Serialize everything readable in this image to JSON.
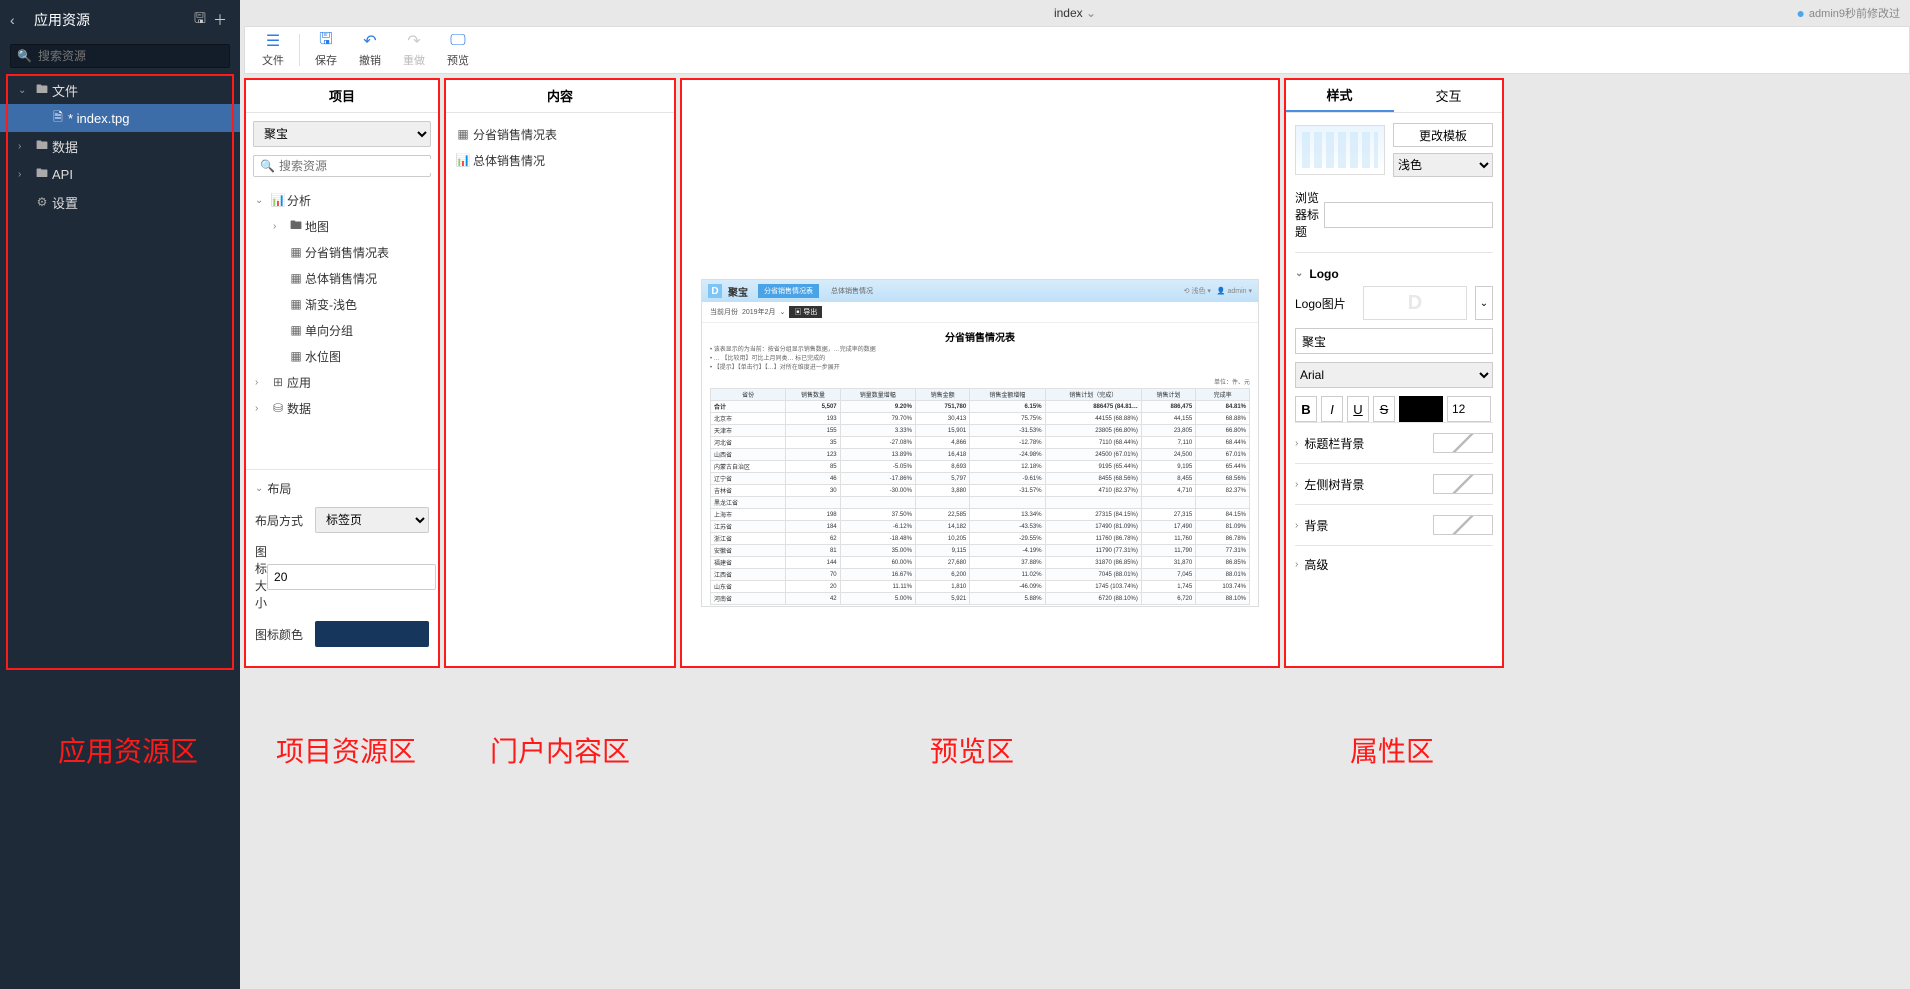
{
  "topbar": {
    "title": "index",
    "modified_by": "admin9秒前修改过"
  },
  "sidebar": {
    "title": "应用资源",
    "search_placeholder": "搜索资源",
    "nodes": {
      "files": "文件",
      "index_file": "* index.tpg",
      "data": "数据",
      "api": "API",
      "settings": "设置"
    }
  },
  "toolbar": {
    "file": "文件",
    "save": "保存",
    "undo": "撤销",
    "redo": "重做",
    "preview": "预览"
  },
  "project": {
    "title": "项目",
    "select_value": "聚宝",
    "search_placeholder": "搜索资源",
    "nodes": {
      "analysis": "分析",
      "map": "地图",
      "prov_sales": "分省销售情况表",
      "overall_sales": "总体销售情况",
      "gradient_light": "渐变-浅色",
      "single_group": "单向分组",
      "water_level": "水位图",
      "app": "应用",
      "data": "数据"
    },
    "layout": {
      "header": "布局",
      "mode_label": "布局方式",
      "mode_value": "标签页",
      "icon_size_label": "图标大小",
      "icon_size_value": "20",
      "icon_color_label": "图标颜色",
      "icon_color_value": "#16365c"
    }
  },
  "content": {
    "title": "内容",
    "items": [
      "分省销售情况表",
      "总体销售情况"
    ]
  },
  "preview": {
    "app_name": "聚宝",
    "tab1": "分省销售情况表",
    "tab2": "总体销售情况",
    "theme_light": "浅色",
    "user": "admin",
    "current_month_label": "当前月份",
    "current_month_value": "2019年2月",
    "export_label": "导出",
    "report_title": "分省销售情况表",
    "notes": [
      "该表显示的为当前：按省分组显示销售数据，…完成率的数据",
      "… 【比较用】可比上月同类… 标已完成的",
      "【提示】【单击行】【…】对所在维度进一步展开"
    ],
    "unit": "单位：件、元",
    "columns": [
      "省份",
      "销售数量",
      "销量数量增幅",
      "销售金额",
      "销售金额增幅",
      "销售计划（完成）",
      "销售计划",
      "完成率"
    ],
    "rows": [
      [
        "合计",
        "5,507",
        "9.20%",
        "751,780",
        "6.15%",
        "886475 (84.81…",
        "886,475",
        "84.81%"
      ],
      [
        "北京市",
        "193",
        "79.70%",
        "30,413",
        "75.75%",
        "44155 (68.88%)",
        "44,155",
        "68.88%"
      ],
      [
        "天津市",
        "155",
        "3.33%",
        "15,901",
        "-31.53%",
        "23805 (66.80%)",
        "23,805",
        "66.80%"
      ],
      [
        "河北省",
        "35",
        "-27.08%",
        "4,866",
        "-12.78%",
        "7110 (68.44%)",
        "7,110",
        "68.44%"
      ],
      [
        "山西省",
        "123",
        "13.89%",
        "16,418",
        "-24.98%",
        "24500 (67.01%)",
        "24,500",
        "67.01%"
      ],
      [
        "内蒙古自治区",
        "85",
        "-5.05%",
        "8,693",
        "12.18%",
        "9195 (65.44%)",
        "9,195",
        "65.44%"
      ],
      [
        "辽宁省",
        "46",
        "-17.86%",
        "5,797",
        "-9.61%",
        "8455 (68.56%)",
        "8,455",
        "68.56%"
      ],
      [
        "吉林省",
        "30",
        "-30.00%",
        "3,880",
        "-31.57%",
        "4710 (82.37%)",
        "4,710",
        "82.37%"
      ],
      [
        "黑龙江省",
        "",
        "",
        "",
        "",
        "",
        "",
        ""
      ],
      [
        "上海市",
        "198",
        "37.50%",
        "22,585",
        "13.34%",
        "27315 (84.15%)",
        "27,315",
        "84.15%"
      ],
      [
        "江苏省",
        "184",
        "-6.12%",
        "14,182",
        "-43.53%",
        "17490 (81.09%)",
        "17,490",
        "81.09%"
      ],
      [
        "浙江省",
        "62",
        "-18.48%",
        "10,205",
        "-29.55%",
        "11760 (86.78%)",
        "11,760",
        "86.78%"
      ],
      [
        "安徽省",
        "81",
        "35.00%",
        "9,115",
        "-4.19%",
        "11790 (77.31%)",
        "11,790",
        "77.31%"
      ],
      [
        "福建省",
        "144",
        "60.00%",
        "27,680",
        "37.88%",
        "31870 (86.85%)",
        "31,870",
        "86.85%"
      ],
      [
        "江西省",
        "70",
        "16.67%",
        "6,200",
        "11.02%",
        "7045 (88.01%)",
        "7,045",
        "88.01%"
      ],
      [
        "山东省",
        "20",
        "11.11%",
        "1,810",
        "-46.09%",
        "1745 (103.74%)",
        "1,745",
        "103.74%"
      ],
      [
        "河南省",
        "42",
        "5.00%",
        "5,921",
        "5.88%",
        "6720 (88.10%)",
        "6,720",
        "88.10%"
      ]
    ]
  },
  "props": {
    "tab_style": "样式",
    "tab_interact": "交互",
    "change_template": "更改模板",
    "theme_light": "浅色",
    "browser_title_label": "浏览器标题",
    "browser_title_value": "",
    "logo_section": "Logo",
    "logo_image_label": "Logo图片",
    "logo_text": "聚宝",
    "font_value": "Arial",
    "font_size": "12",
    "title_bg": "标题栏背景",
    "left_tree_bg": "左侧树背景",
    "bg": "背景",
    "advanced": "高级"
  },
  "annotations": {
    "sidebar": "应用资源区",
    "project": "项目资源区",
    "content": "门户内容区",
    "preview": "预览区",
    "props": "属性区"
  },
  "chart_data": {
    "type": "table",
    "title": "分省销售情况表",
    "columns": [
      "省份",
      "销售数量",
      "销量数量增幅",
      "销售金额",
      "销售金额增幅",
      "完成率"
    ],
    "rows": [
      {
        "province": "合计",
        "qty": 5507,
        "qty_growth": 9.2,
        "amount": 751780,
        "amount_growth": 6.15,
        "plan": 886475,
        "completion_rate": 84.81
      },
      {
        "province": "北京市",
        "qty": 193,
        "qty_growth": 79.7,
        "amount": 30413,
        "amount_growth": 75.75,
        "plan": 44155,
        "completion_rate": 68.88
      },
      {
        "province": "天津市",
        "qty": 155,
        "qty_growth": 3.33,
        "amount": 15901,
        "amount_growth": -31.53,
        "plan": 23805,
        "completion_rate": 66.8
      },
      {
        "province": "河北省",
        "qty": 35,
        "qty_growth": -27.08,
        "amount": 4866,
        "amount_growth": -12.78,
        "plan": 7110,
        "completion_rate": 68.44
      },
      {
        "province": "山西省",
        "qty": 123,
        "qty_growth": 13.89,
        "amount": 16418,
        "amount_growth": -24.98,
        "plan": 24500,
        "completion_rate": 67.01
      },
      {
        "province": "内蒙古自治区",
        "qty": 85,
        "qty_growth": -5.05,
        "amount": 8693,
        "amount_growth": 12.18,
        "plan": 9195,
        "completion_rate": 65.44
      },
      {
        "province": "辽宁省",
        "qty": 46,
        "qty_growth": -17.86,
        "amount": 5797,
        "amount_growth": -9.61,
        "plan": 8455,
        "completion_rate": 68.56
      },
      {
        "province": "吉林省",
        "qty": 30,
        "qty_growth": -30.0,
        "amount": 3880,
        "amount_growth": -31.57,
        "plan": 4710,
        "completion_rate": 82.37
      },
      {
        "province": "黑龙江省",
        "qty": null,
        "qty_growth": null,
        "amount": null,
        "amount_growth": null,
        "plan": null,
        "completion_rate": null
      },
      {
        "province": "上海市",
        "qty": 198,
        "qty_growth": 37.5,
        "amount": 22585,
        "amount_growth": 13.34,
        "plan": 27315,
        "completion_rate": 84.15
      },
      {
        "province": "江苏省",
        "qty": 184,
        "qty_growth": -6.12,
        "amount": 14182,
        "amount_growth": -43.53,
        "plan": 17490,
        "completion_rate": 81.09
      },
      {
        "province": "浙江省",
        "qty": 62,
        "qty_growth": -18.48,
        "amount": 10205,
        "amount_growth": -29.55,
        "plan": 11760,
        "completion_rate": 86.78
      },
      {
        "province": "安徽省",
        "qty": 81,
        "qty_growth": 35.0,
        "amount": 9115,
        "amount_growth": -4.19,
        "plan": 11790,
        "completion_rate": 77.31
      },
      {
        "province": "福建省",
        "qty": 144,
        "qty_growth": 60.0,
        "amount": 27680,
        "amount_growth": 37.88,
        "plan": 31870,
        "completion_rate": 86.85
      },
      {
        "province": "江西省",
        "qty": 70,
        "qty_growth": 16.67,
        "amount": 6200,
        "amount_growth": 11.02,
        "plan": 7045,
        "completion_rate": 88.01
      },
      {
        "province": "山东省",
        "qty": 20,
        "qty_growth": 11.11,
        "amount": 1810,
        "amount_growth": -46.09,
        "plan": 1745,
        "completion_rate": 103.74
      },
      {
        "province": "河南省",
        "qty": 42,
        "qty_growth": 5.0,
        "amount": 5921,
        "amount_growth": 5.88,
        "plan": 6720,
        "completion_rate": 88.1
      }
    ]
  }
}
